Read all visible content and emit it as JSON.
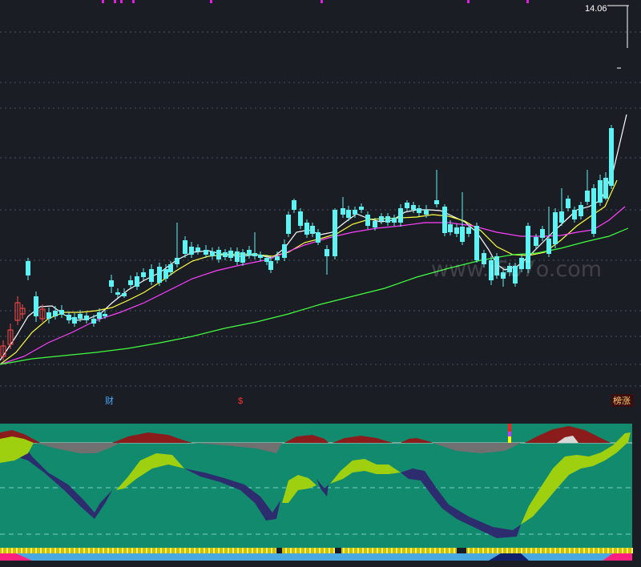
{
  "chart_data": {
    "type": "candlestick",
    "price_labels": {
      "high": "14.06",
      "low": ""
    },
    "markers": [
      {
        "label": "财",
        "color": "#4aa8ff"
      },
      {
        "label": "$",
        "color": "#ff3030"
      },
      {
        "label": "榜涨",
        "color": "#ffcc66"
      }
    ],
    "watermark": "www.i6o7o.com",
    "grid": true,
    "candles_note": "",
    "series": []
  },
  "colors": {
    "up": "#ff4a4a",
    "down": "#5ef2f2",
    "ma5": "#ffffff",
    "ma10": "#ffff40",
    "ma20": "#ff40ff",
    "ma60": "#40ff40",
    "indicator_bg": "#128a6e",
    "upper_band": "#8b1c1c",
    "lower_band": "#2c2c6e",
    "lime": "#9ed010"
  }
}
